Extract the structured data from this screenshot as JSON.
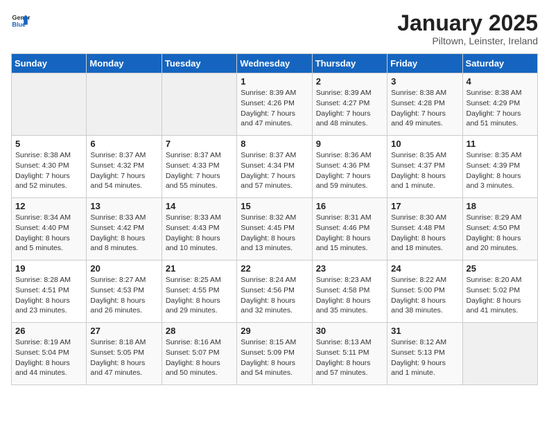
{
  "header": {
    "logo_general": "General",
    "logo_blue": "Blue",
    "title": "January 2025",
    "subtitle": "Piltown, Leinster, Ireland"
  },
  "days_of_week": [
    "Sunday",
    "Monday",
    "Tuesday",
    "Wednesday",
    "Thursday",
    "Friday",
    "Saturday"
  ],
  "weeks": [
    [
      {
        "day": "",
        "info": ""
      },
      {
        "day": "",
        "info": ""
      },
      {
        "day": "",
        "info": ""
      },
      {
        "day": "1",
        "info": "Sunrise: 8:39 AM\nSunset: 4:26 PM\nDaylight: 7 hours\nand 47 minutes."
      },
      {
        "day": "2",
        "info": "Sunrise: 8:39 AM\nSunset: 4:27 PM\nDaylight: 7 hours\nand 48 minutes."
      },
      {
        "day": "3",
        "info": "Sunrise: 8:38 AM\nSunset: 4:28 PM\nDaylight: 7 hours\nand 49 minutes."
      },
      {
        "day": "4",
        "info": "Sunrise: 8:38 AM\nSunset: 4:29 PM\nDaylight: 7 hours\nand 51 minutes."
      }
    ],
    [
      {
        "day": "5",
        "info": "Sunrise: 8:38 AM\nSunset: 4:30 PM\nDaylight: 7 hours\nand 52 minutes."
      },
      {
        "day": "6",
        "info": "Sunrise: 8:37 AM\nSunset: 4:32 PM\nDaylight: 7 hours\nand 54 minutes."
      },
      {
        "day": "7",
        "info": "Sunrise: 8:37 AM\nSunset: 4:33 PM\nDaylight: 7 hours\nand 55 minutes."
      },
      {
        "day": "8",
        "info": "Sunrise: 8:37 AM\nSunset: 4:34 PM\nDaylight: 7 hours\nand 57 minutes."
      },
      {
        "day": "9",
        "info": "Sunrise: 8:36 AM\nSunset: 4:36 PM\nDaylight: 7 hours\nand 59 minutes."
      },
      {
        "day": "10",
        "info": "Sunrise: 8:35 AM\nSunset: 4:37 PM\nDaylight: 8 hours\nand 1 minute."
      },
      {
        "day": "11",
        "info": "Sunrise: 8:35 AM\nSunset: 4:39 PM\nDaylight: 8 hours\nand 3 minutes."
      }
    ],
    [
      {
        "day": "12",
        "info": "Sunrise: 8:34 AM\nSunset: 4:40 PM\nDaylight: 8 hours\nand 5 minutes."
      },
      {
        "day": "13",
        "info": "Sunrise: 8:33 AM\nSunset: 4:42 PM\nDaylight: 8 hours\nand 8 minutes."
      },
      {
        "day": "14",
        "info": "Sunrise: 8:33 AM\nSunset: 4:43 PM\nDaylight: 8 hours\nand 10 minutes."
      },
      {
        "day": "15",
        "info": "Sunrise: 8:32 AM\nSunset: 4:45 PM\nDaylight: 8 hours\nand 13 minutes."
      },
      {
        "day": "16",
        "info": "Sunrise: 8:31 AM\nSunset: 4:46 PM\nDaylight: 8 hours\nand 15 minutes."
      },
      {
        "day": "17",
        "info": "Sunrise: 8:30 AM\nSunset: 4:48 PM\nDaylight: 8 hours\nand 18 minutes."
      },
      {
        "day": "18",
        "info": "Sunrise: 8:29 AM\nSunset: 4:50 PM\nDaylight: 8 hours\nand 20 minutes."
      }
    ],
    [
      {
        "day": "19",
        "info": "Sunrise: 8:28 AM\nSunset: 4:51 PM\nDaylight: 8 hours\nand 23 minutes."
      },
      {
        "day": "20",
        "info": "Sunrise: 8:27 AM\nSunset: 4:53 PM\nDaylight: 8 hours\nand 26 minutes."
      },
      {
        "day": "21",
        "info": "Sunrise: 8:25 AM\nSunset: 4:55 PM\nDaylight: 8 hours\nand 29 minutes."
      },
      {
        "day": "22",
        "info": "Sunrise: 8:24 AM\nSunset: 4:56 PM\nDaylight: 8 hours\nand 32 minutes."
      },
      {
        "day": "23",
        "info": "Sunrise: 8:23 AM\nSunset: 4:58 PM\nDaylight: 8 hours\nand 35 minutes."
      },
      {
        "day": "24",
        "info": "Sunrise: 8:22 AM\nSunset: 5:00 PM\nDaylight: 8 hours\nand 38 minutes."
      },
      {
        "day": "25",
        "info": "Sunrise: 8:20 AM\nSunset: 5:02 PM\nDaylight: 8 hours\nand 41 minutes."
      }
    ],
    [
      {
        "day": "26",
        "info": "Sunrise: 8:19 AM\nSunset: 5:04 PM\nDaylight: 8 hours\nand 44 minutes."
      },
      {
        "day": "27",
        "info": "Sunrise: 8:18 AM\nSunset: 5:05 PM\nDaylight: 8 hours\nand 47 minutes."
      },
      {
        "day": "28",
        "info": "Sunrise: 8:16 AM\nSunset: 5:07 PM\nDaylight: 8 hours\nand 50 minutes."
      },
      {
        "day": "29",
        "info": "Sunrise: 8:15 AM\nSunset: 5:09 PM\nDaylight: 8 hours\nand 54 minutes."
      },
      {
        "day": "30",
        "info": "Sunrise: 8:13 AM\nSunset: 5:11 PM\nDaylight: 8 hours\nand 57 minutes."
      },
      {
        "day": "31",
        "info": "Sunrise: 8:12 AM\nSunset: 5:13 PM\nDaylight: 9 hours\nand 1 minute."
      },
      {
        "day": "",
        "info": ""
      }
    ]
  ]
}
